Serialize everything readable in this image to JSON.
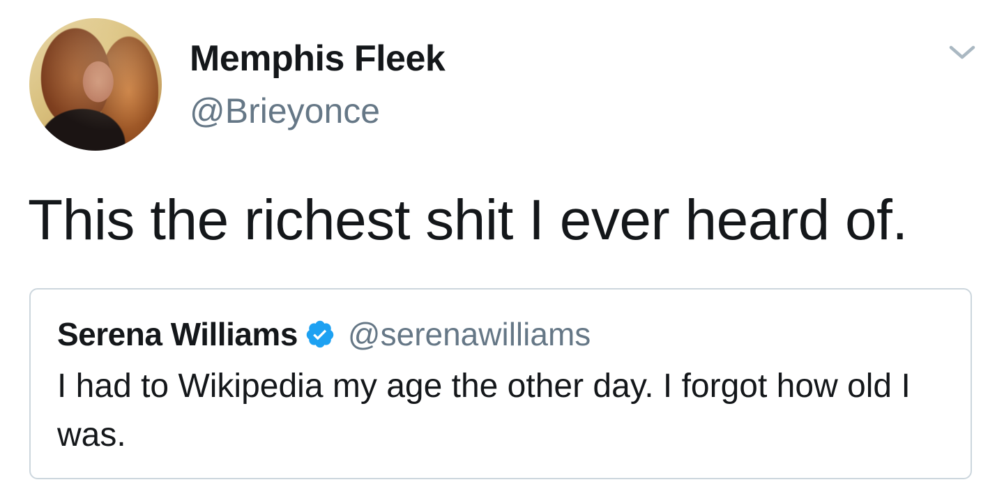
{
  "tweet": {
    "author": {
      "display_name": "Memphis Fleek",
      "handle": "@Brieyonce",
      "avatar_icon": "profile-photo"
    },
    "text": "This the richest shit I ever heard of.",
    "menu_icon": "chevron-down-icon"
  },
  "quoted_tweet": {
    "author": {
      "display_name": "Serena Williams",
      "handle": "@serenawilliams",
      "verified": true,
      "verified_color": "#1da1f2"
    },
    "text": "I had to Wikipedia my age the other day. I forgot how old I was."
  },
  "colors": {
    "primary_text": "#14171a",
    "secondary_text": "#657786",
    "border": "#ccd6dd",
    "accent": "#1da1f2"
  }
}
